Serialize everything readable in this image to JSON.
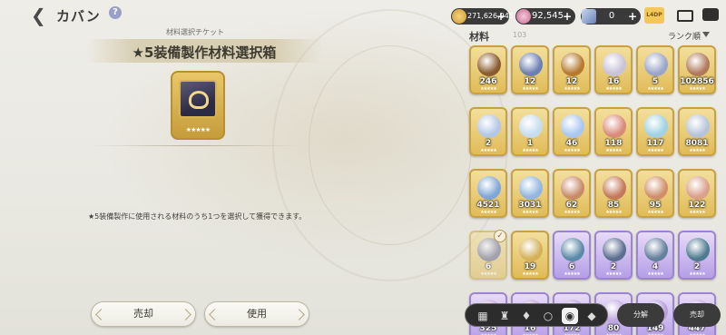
{
  "header": {
    "back_icon": "chevron-left-icon",
    "title": "カバン",
    "help_label": "?"
  },
  "currencies": {
    "gold": "271,626,945",
    "gems": "92,545",
    "crystals": "0",
    "ticket_label": "L4DP"
  },
  "selected_item": {
    "category": "材料選択チケット",
    "name": "★5装備製作材料選択箱",
    "stars": "★★★★★",
    "description": "★5装備製作に使用される材料のうち1つを選択して獲得できます。"
  },
  "buttons": {
    "sell": "売却",
    "use": "使用"
  },
  "inventory": {
    "tab_label": "材料",
    "count": "103",
    "sort_label": "ランク順",
    "row1": [
      "246",
      "12",
      "12",
      "16",
      "5",
      "102856"
    ],
    "row2": [
      "2",
      "1",
      "46",
      "118",
      "117",
      "8081"
    ],
    "row3": [
      "4521",
      "3031",
      "62",
      "85",
      "95",
      "122"
    ],
    "row4": [
      "6",
      "19",
      "6",
      "2",
      "4",
      "2"
    ],
    "row5": [
      "325",
      "16",
      "172",
      "80",
      "149",
      "447"
    ],
    "slot_stars": "★★★★★",
    "check": "✓"
  },
  "toolbar": {
    "grid_icon": "grid-icon",
    "decompose_label": "分解",
    "sellall_label": "売却"
  },
  "colors": {
    "gold_slot": "#e0bb57",
    "purple_slot": "#b59ee6",
    "background": "#eeede8"
  }
}
